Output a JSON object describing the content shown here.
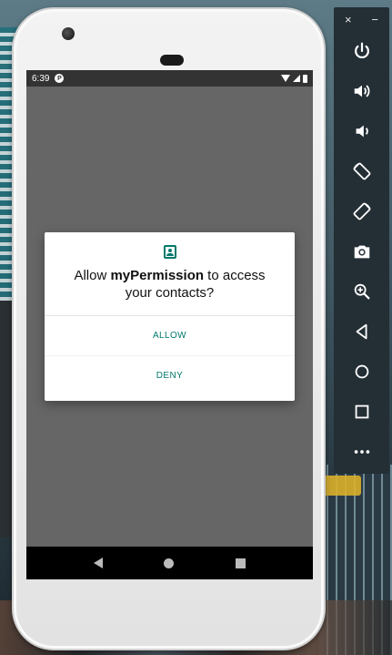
{
  "status_bar": {
    "time": "6:39",
    "app_icon_glyph": "P"
  },
  "dialog": {
    "message_prefix": "Allow ",
    "app_name": "myPermission",
    "message_suffix": " to access your contacts?",
    "allow_label": "ALLOW",
    "deny_label": "DENY",
    "icon": "contacts-icon",
    "accent_color": "#00796b"
  },
  "navbar": {
    "icons": [
      "nav-back-icon",
      "nav-home-icon",
      "nav-recents-icon"
    ]
  },
  "emulator_toolbar": {
    "close_glyph": "×",
    "minimize_glyph": "−",
    "buttons": [
      "power-icon",
      "volume-up-icon",
      "volume-down-icon",
      "rotate-left-icon",
      "rotate-right-icon",
      "camera-icon",
      "zoom-icon",
      "back-icon",
      "home-icon",
      "overview-icon",
      "more-icon"
    ]
  }
}
